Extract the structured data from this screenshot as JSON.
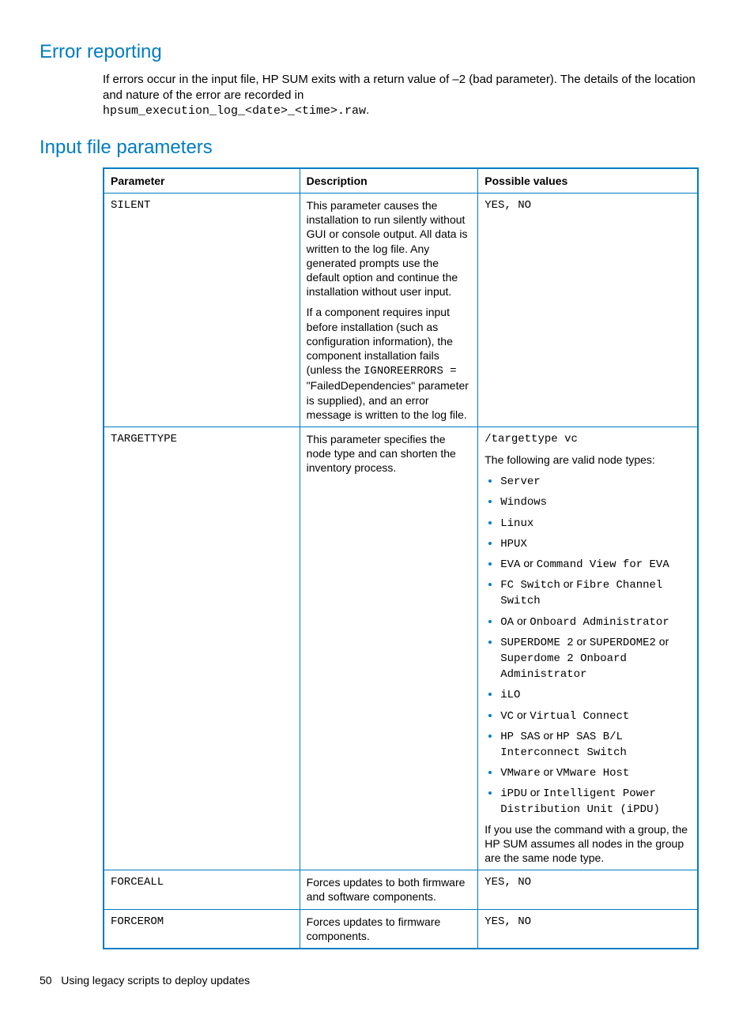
{
  "section1": {
    "heading": "Error reporting",
    "para_pre": "If errors occur in the input file, HP SUM exits with a return value of –2 (bad parameter). The details of the location and nature of the error are recorded in ",
    "para_code": "hpsum_execution_log_<date>_<time>.raw",
    "para_post": "."
  },
  "section2": {
    "heading": "Input file parameters",
    "columns": {
      "c1": "Parameter",
      "c2": "Description",
      "c3": "Possible values"
    },
    "rows": {
      "r1": {
        "param": "SILENT",
        "desc_p1": "This parameter causes the installation to run silently without GUI or console output. All data is written to the log file. Any generated prompts use the default option and continue the installation without user input.",
        "desc_p2_a": "If a component requires input before installation (such as configuration information), the component installation fails (unless the ",
        "desc_p2_code": "IGNOREERRORS =",
        "desc_p2_b": " \"FailedDependencies\" parameter is supplied), and an error message is written to the log file.",
        "vals": "YES, NO"
      },
      "r2": {
        "param": "TARGETTYPE",
        "desc": "This parameter specifies the node type and can shorten the inventory process.",
        "vals_ex": "/targettype vc",
        "vals_intro": "The following are valid node types:",
        "items": {
          "i1": {
            "a": "Server"
          },
          "i2": {
            "a": "Windows"
          },
          "i3": {
            "a": "Linux"
          },
          "i4": {
            "a": "HPUX"
          },
          "i5": {
            "a": "EVA",
            "sep": " or ",
            "b": "Command View for EVA"
          },
          "i6": {
            "a": "FC Switch",
            "sep": " or ",
            "b": "Fibre Channel Switch"
          },
          "i7": {
            "a": "OA",
            "sep": " or ",
            "b": "Onboard Administrator"
          },
          "i8": {
            "a": "SUPERDOME 2",
            "sep": " or ",
            "b": "SUPERDOME2",
            "sep2": " or ",
            "c": "Superdome 2 Onboard Administrator"
          },
          "i9": {
            "a": "iLO"
          },
          "i10": {
            "a": "VC",
            "sep": " or ",
            "b": "Virtual Connect"
          },
          "i11": {
            "a": "HP SAS",
            "sep": " or ",
            "b": "HP SAS B/L Interconnect Switch"
          },
          "i12": {
            "a": "VMware",
            "sep": " or ",
            "b": "VMware Host"
          },
          "i13": {
            "a": "iPDU",
            "sep": " or ",
            "b": "Intelligent Power Distribution Unit (iPDU)"
          }
        },
        "vals_outro": "If you use the command with a group, the HP SUM assumes all nodes in the group are the same node type."
      },
      "r3": {
        "param": "FORCEALL",
        "desc": "Forces updates to both firmware and software components.",
        "vals": "YES, NO"
      },
      "r4": {
        "param": "FORCEROM",
        "desc": "Forces updates to firmware components.",
        "vals": "YES, NO"
      }
    }
  },
  "footer": {
    "page": "50",
    "title": "Using legacy scripts to deploy updates"
  }
}
